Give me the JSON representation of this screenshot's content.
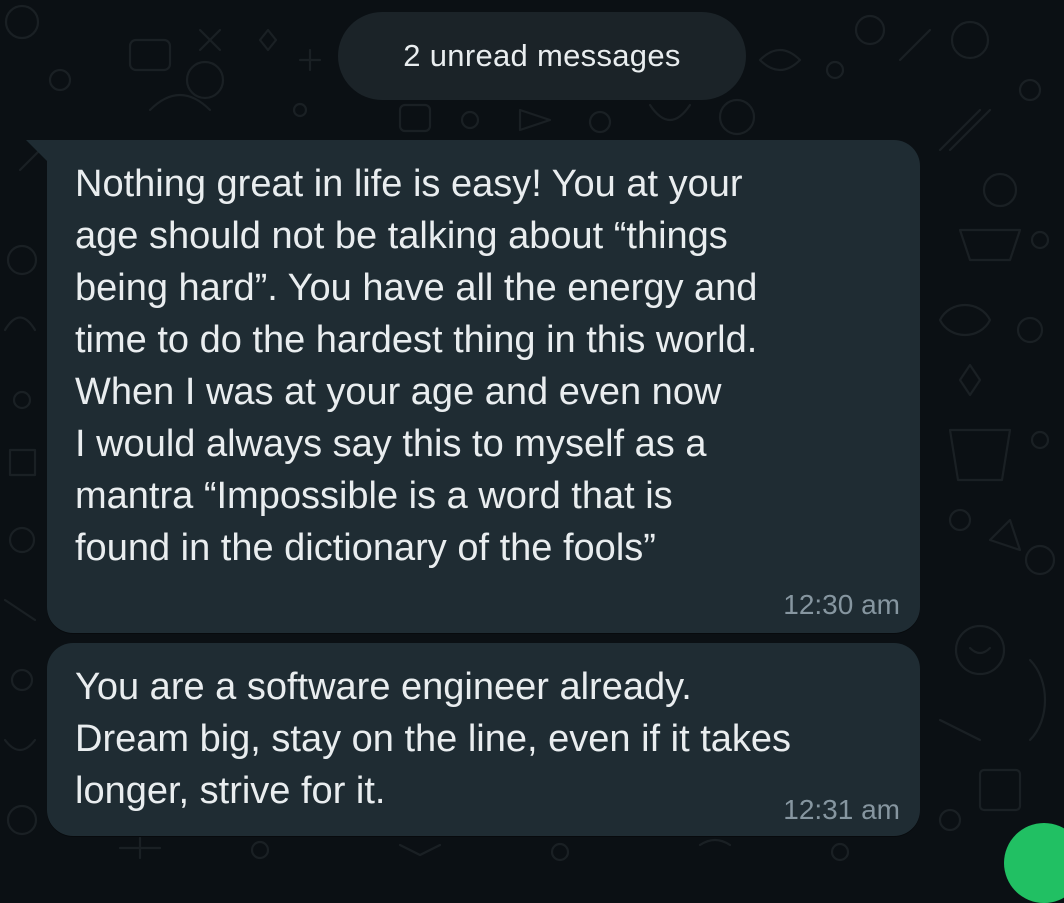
{
  "banner": {
    "unread_label": "2 unread messages"
  },
  "messages": [
    {
      "text": "Nothing great in life is easy! You at your\nage should not be talking about “things\nbeing hard”. You have all the energy and\ntime to do the hardest thing in this world.\nWhen I was at your age and even now\nI would always say this to myself as a\nmantra “Impossible is a word that is\nfound in the dictionary of the fools”",
      "time": "12:30 am"
    },
    {
      "text": "You are a software engineer already.\nDream big, stay on the line, even if it takes\nlonger, strive for it.",
      "time": "12:31 am"
    }
  ],
  "colors": {
    "background": "#0b1014",
    "bubble": "#1f2c33",
    "pill": "#1b2328",
    "text": "#e9edef",
    "meta": "#8696a0",
    "accent": "#21c063"
  }
}
